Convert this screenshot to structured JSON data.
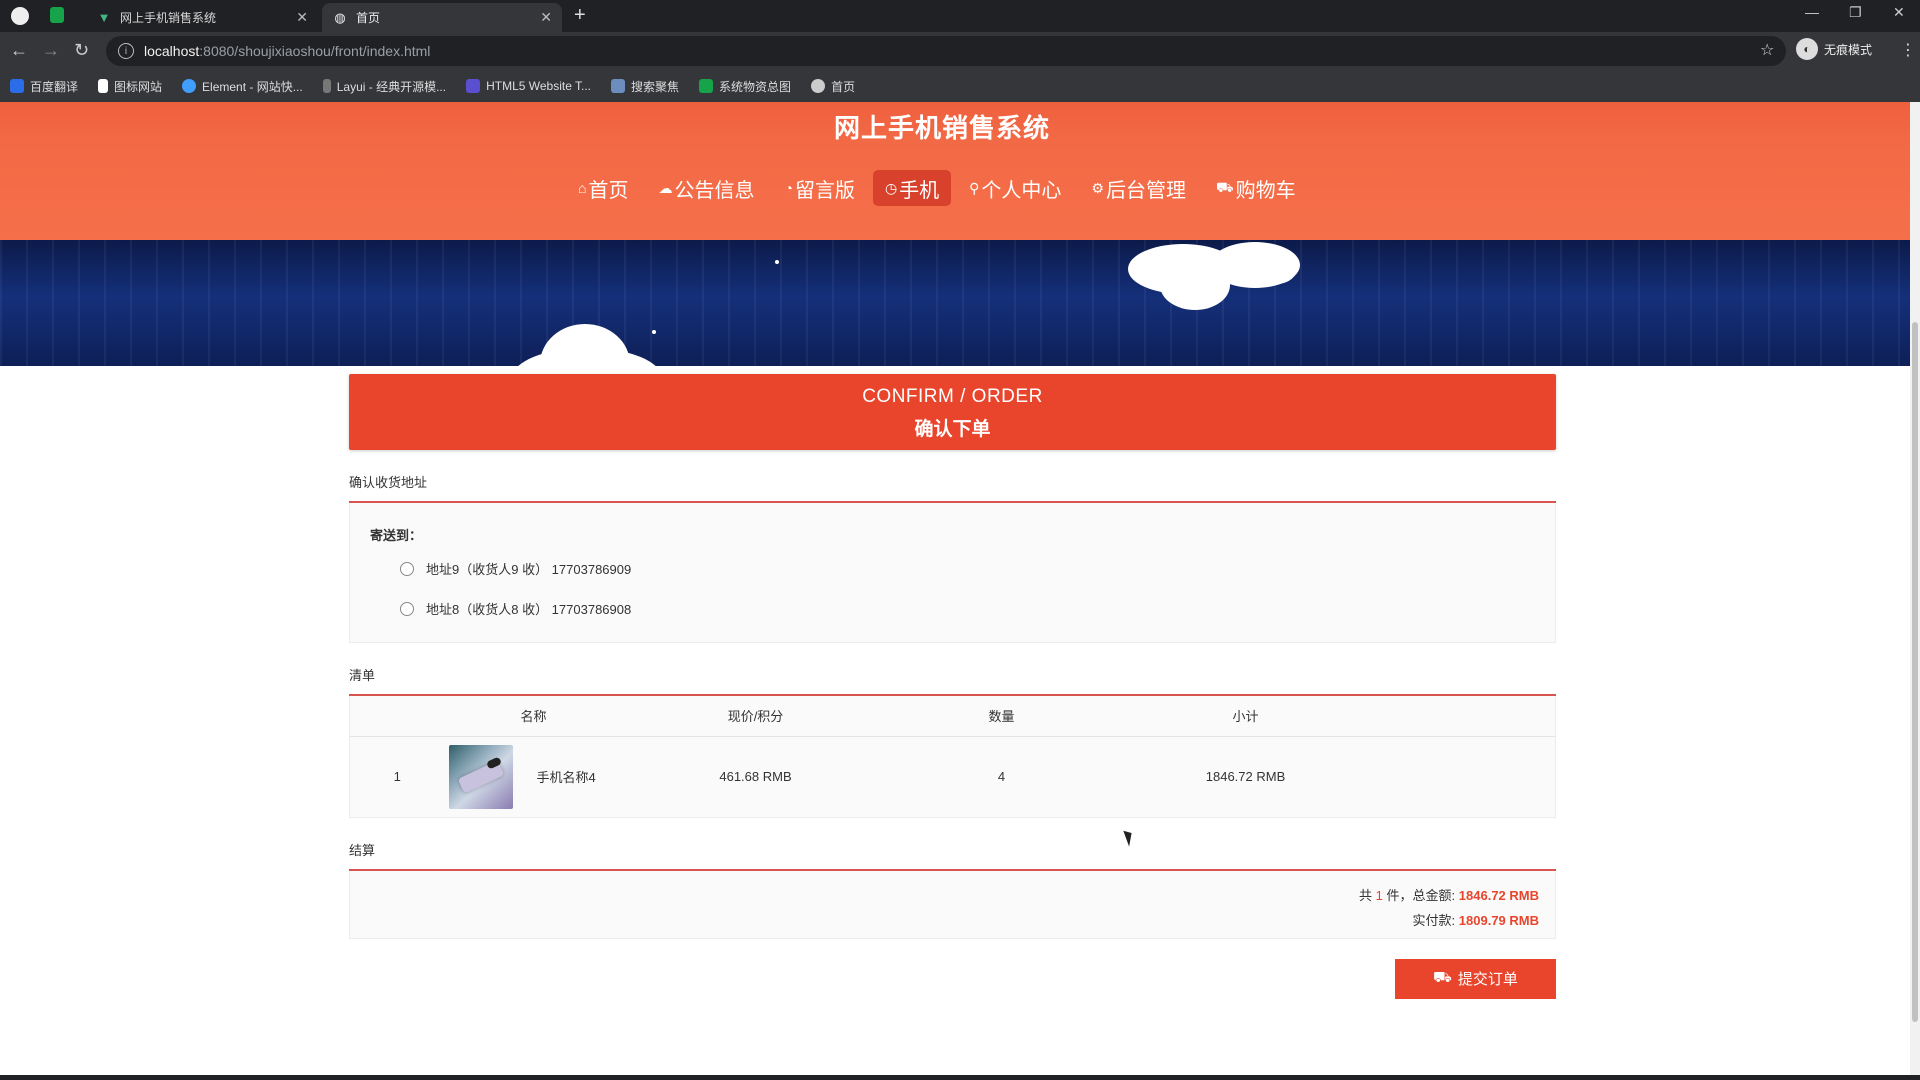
{
  "browser": {
    "tabs": [
      {
        "title": "网上手机销售系统",
        "favicon": "vue-logo-icon",
        "color": "#41b883"
      },
      {
        "title": "首页",
        "favicon": "globe-icon",
        "color": "#cccccc"
      }
    ],
    "address": {
      "host": "localhost",
      "path": ":8080/shoujixiaoshou/front/index.html"
    },
    "profile_label": "无痕模式",
    "bookmarks": [
      {
        "label": "百度翻译",
        "color": "#2b6de8"
      },
      {
        "label": "图标网站",
        "color": "#ffffff"
      },
      {
        "label": "Element - 网站快...",
        "color": "#409eff"
      },
      {
        "label": "Layui - 经典开源模...",
        "color": "#dddddd"
      },
      {
        "label": "HTML5 Website T...",
        "color": "#5a4fcf"
      },
      {
        "label": "搜索聚焦",
        "color": "#6c8ebf"
      },
      {
        "label": "系统物资总图",
        "color": "#16a34a"
      },
      {
        "label": "首页",
        "color": "#cccccc"
      }
    ]
  },
  "site": {
    "title": "网上手机销售系统",
    "nav": [
      {
        "label": "首页",
        "icon": "⌂"
      },
      {
        "label": "公告信息",
        "icon": "☁"
      },
      {
        "label": "留言版",
        "icon": "◔"
      },
      {
        "label": "手机",
        "icon": "◷"
      },
      {
        "label": "个人中心",
        "icon": "⚲"
      },
      {
        "label": "后台管理",
        "icon": "⚙"
      },
      {
        "label": "购物车",
        "icon": "⛟"
      }
    ],
    "active_nav": "手机"
  },
  "order": {
    "header_en": "CONFIRM / ORDER",
    "header_zh": "确认下单",
    "address_section_title": "确认收货地址",
    "send_to_label": "寄送到：",
    "addresses": [
      {
        "text": "地址9（收货人9 收） 17703786909"
      },
      {
        "text": "地址8（收货人8 收） 17703786908"
      }
    ],
    "list_section_title": "清单",
    "columns": [
      "名称",
      "现价/积分",
      "数量",
      "小计"
    ],
    "items": [
      {
        "index": "1",
        "name": "手机名称4",
        "price": "461.68 RMB",
        "qty": "4",
        "subtotal": "1846.72 RMB"
      }
    ],
    "settle_section_title": "结算",
    "summary": {
      "count_prefix": "共",
      "count": "1",
      "count_suffix": "件，总金额:",
      "total": "1846.72 RMB",
      "paid_label": "实付款:",
      "paid": "1809.79 RMB"
    },
    "submit_label": "提交订单"
  },
  "colors": {
    "primary": "#e8452c",
    "header": "#f26a45",
    "nav_active": "#d8412b"
  }
}
